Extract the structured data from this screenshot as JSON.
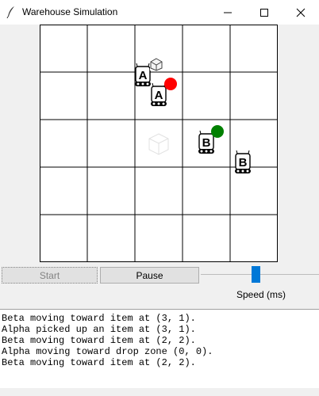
{
  "window": {
    "title": "Warehouse Simulation",
    "controls": [
      "minimize",
      "maximize",
      "close"
    ]
  },
  "grid": {
    "rows": 5,
    "cols": 5,
    "drop_zone_icon": "faded-box-icon",
    "robots": [
      {
        "name": "A",
        "icon": "robot-icon",
        "badge": "box",
        "badge_icon": "package-icon"
      },
      {
        "name": "A",
        "icon": "robot-icon",
        "badge": "red-dot",
        "badge_color": "#ff0000"
      },
      {
        "name": "B",
        "icon": "robot-icon",
        "badge": "green-dot",
        "badge_color": "#008000"
      },
      {
        "name": "B",
        "icon": "robot-icon",
        "badge": "none"
      }
    ]
  },
  "controls": {
    "start_label": "Start",
    "pause_label": "Pause",
    "speed_label": "Speed (ms)"
  },
  "log": [
    "Beta moving toward item at (3, 1).",
    "Alpha picked up an item at (3, 1).",
    "Beta moving toward item at (2, 2).",
    "Alpha moving toward drop zone (0, 0).",
    "Beta moving toward item at (2, 2)."
  ],
  "colors": {
    "accent": "#0078d7",
    "grid_line": "#000000",
    "red_marker": "#ff0000",
    "green_marker": "#008000"
  }
}
